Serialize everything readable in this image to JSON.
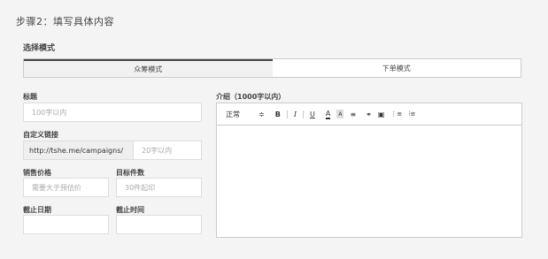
{
  "step_title": "步骤2：填写具体内容",
  "mode_label": "选择模式",
  "tabs": [
    {
      "label": "众筹模式",
      "active": true
    },
    {
      "label": "下单模式",
      "active": false
    }
  ],
  "fields": {
    "title": {
      "label": "标题",
      "placeholder": "100字以内"
    },
    "custom_link": {
      "label": "自定义链接",
      "prefix": "http://tshe.me/campaigns/",
      "placeholder": "20字以内"
    },
    "price": {
      "label": "销售价格",
      "placeholder": "需要大于预估价"
    },
    "target": {
      "label": "目标件数",
      "placeholder": "30件起印"
    },
    "end_date": {
      "label": "截止日期",
      "placeholder": ""
    },
    "end_time": {
      "label": "截止时间",
      "placeholder": ""
    },
    "intro": {
      "label": "介绍（1000字以内）"
    }
  },
  "toolbar": {
    "format_select": "正常",
    "format_arrow": "≑",
    "bold": "B",
    "italic": "I",
    "underline": "U",
    "font_color": "A",
    "bg_color": "A",
    "align": "≡",
    "link": "⚭",
    "image": "▣",
    "ordered_list": "⋮≡",
    "bullet_list": "⁝≡"
  }
}
